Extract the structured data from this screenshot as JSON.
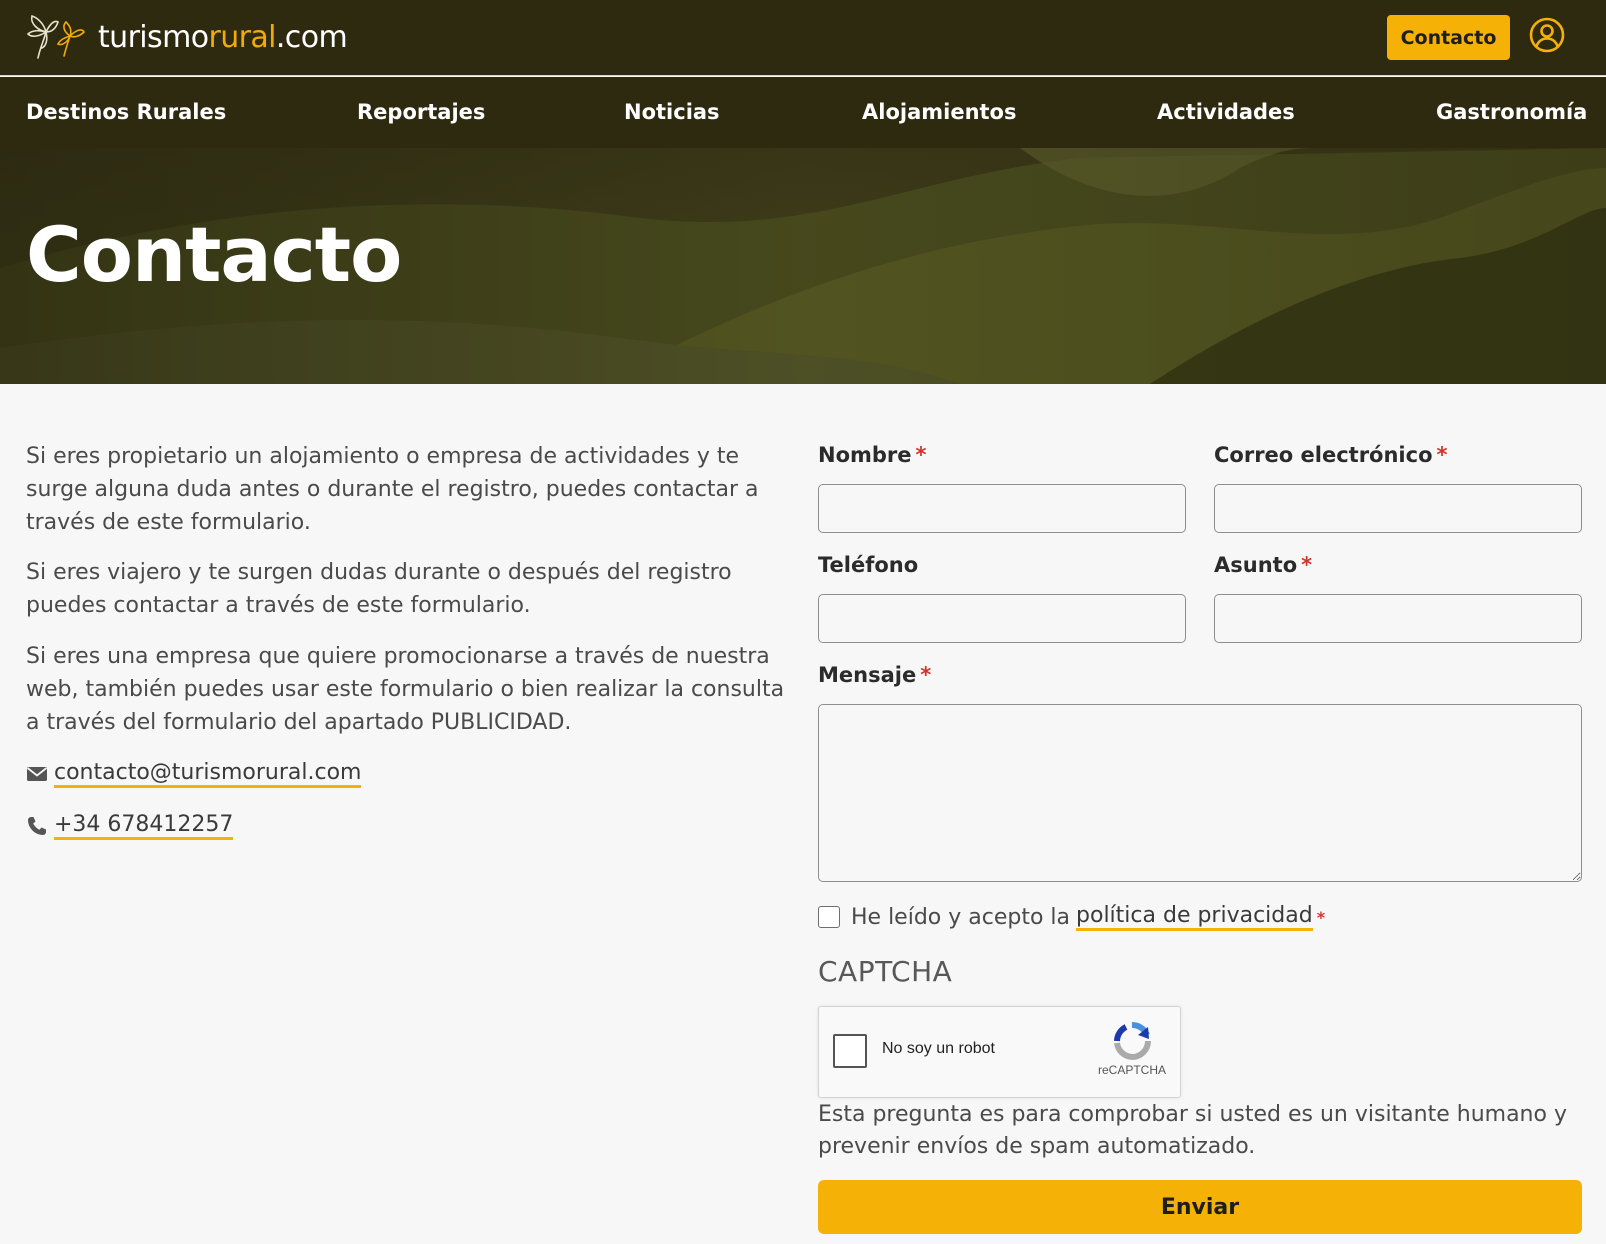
{
  "brand": {
    "logo_text_main": "turismo",
    "logo_text_accent": "rural",
    "logo_text_suffix": ".com",
    "accent_color": "#f5b106",
    "dark_color": "#2e2a10"
  },
  "header": {
    "contact_button": "Contacto",
    "user_icon": "user-circle-icon"
  },
  "nav": {
    "items": [
      {
        "label": "Destinos Rurales"
      },
      {
        "label": "Reportajes"
      },
      {
        "label": "Noticias"
      },
      {
        "label": "Alojamientos"
      },
      {
        "label": "Actividades"
      },
      {
        "label": "Gastronomía"
      }
    ]
  },
  "hero": {
    "title": "Contacto"
  },
  "intro": {
    "paragraphs": [
      "Si eres propietario un alojamiento o empresa de actividades y te surge alguna duda antes o durante el registro, puedes contactar a través de este formulario.",
      "Si eres viajero y te surgen dudas durante o después del registro puedes contactar a través de este formulario.",
      "Si eres una empresa que quiere promocionarse a través de nuestra web, también puedes usar este formulario o bien realizar la consulta a través del formulario del apartado PUBLICIDAD."
    ],
    "email": "contacto@turismorural.com",
    "phone": "+34 678412257"
  },
  "form": {
    "name_label": "Nombre",
    "email_label": "Correo electrónico",
    "phone_label": "Teléfono",
    "subject_label": "Asunto",
    "message_label": "Mensaje",
    "required_mark": "*",
    "name_value": "",
    "email_value": "",
    "phone_value": "",
    "subject_value": "",
    "message_value": "",
    "privacy_text": "He leído y acepto la",
    "privacy_link": "política de privacidad",
    "privacy_checked": false,
    "captcha_heading": "CAPTCHA",
    "recaptcha_label": "No soy un robot",
    "recaptcha_brand": "reCAPTCHA",
    "captcha_description": "Esta pregunta es para comprobar si usted es un visitante humano y prevenir envíos de spam automatizado.",
    "submit_label": "Enviar"
  }
}
